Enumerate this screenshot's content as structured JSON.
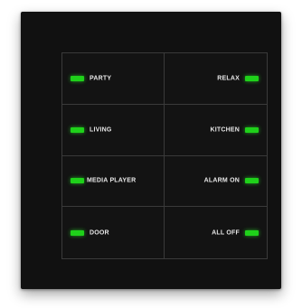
{
  "keypad": {
    "left": [
      "PARTY",
      "LIVING",
      "MEDIA PLAYER",
      "DOOR"
    ],
    "right": [
      "RELAX",
      "KITCHEN",
      "ALARM ON",
      "ALL OFF"
    ]
  },
  "colors": {
    "panel": "#111111",
    "led": "#1fd11a",
    "label": "#e8e8e8"
  },
  "icons": {
    "indicator": "green-led-indicator"
  }
}
